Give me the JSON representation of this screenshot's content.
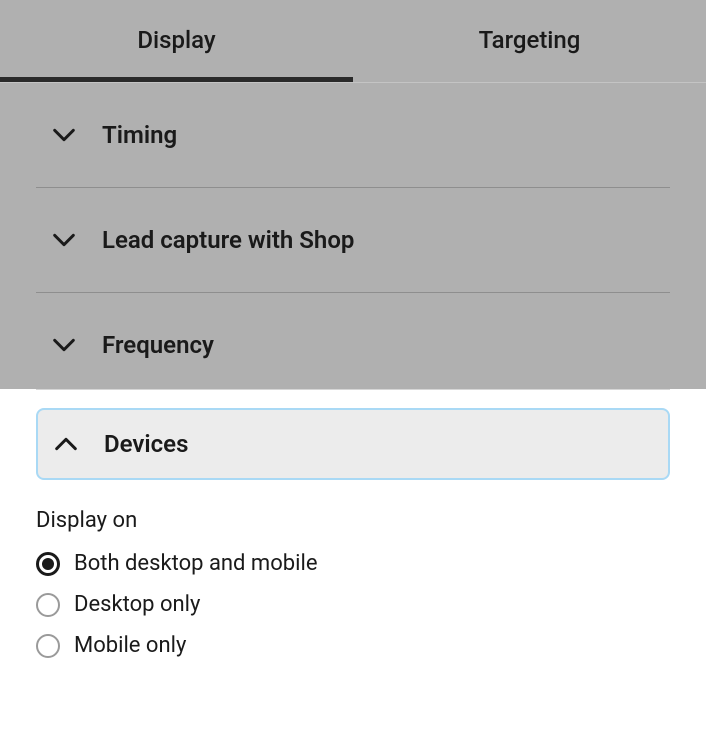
{
  "tabs": {
    "display": "Display",
    "targeting": "Targeting",
    "active": "display"
  },
  "accordion": {
    "timing": "Timing",
    "leadCapture": "Lead capture with Shop",
    "frequency": "Frequency",
    "devices": "Devices"
  },
  "devicesSection": {
    "title": "Display on",
    "options": {
      "both": "Both desktop and mobile",
      "desktop": "Desktop only",
      "mobile": "Mobile only"
    },
    "selected": "both"
  }
}
